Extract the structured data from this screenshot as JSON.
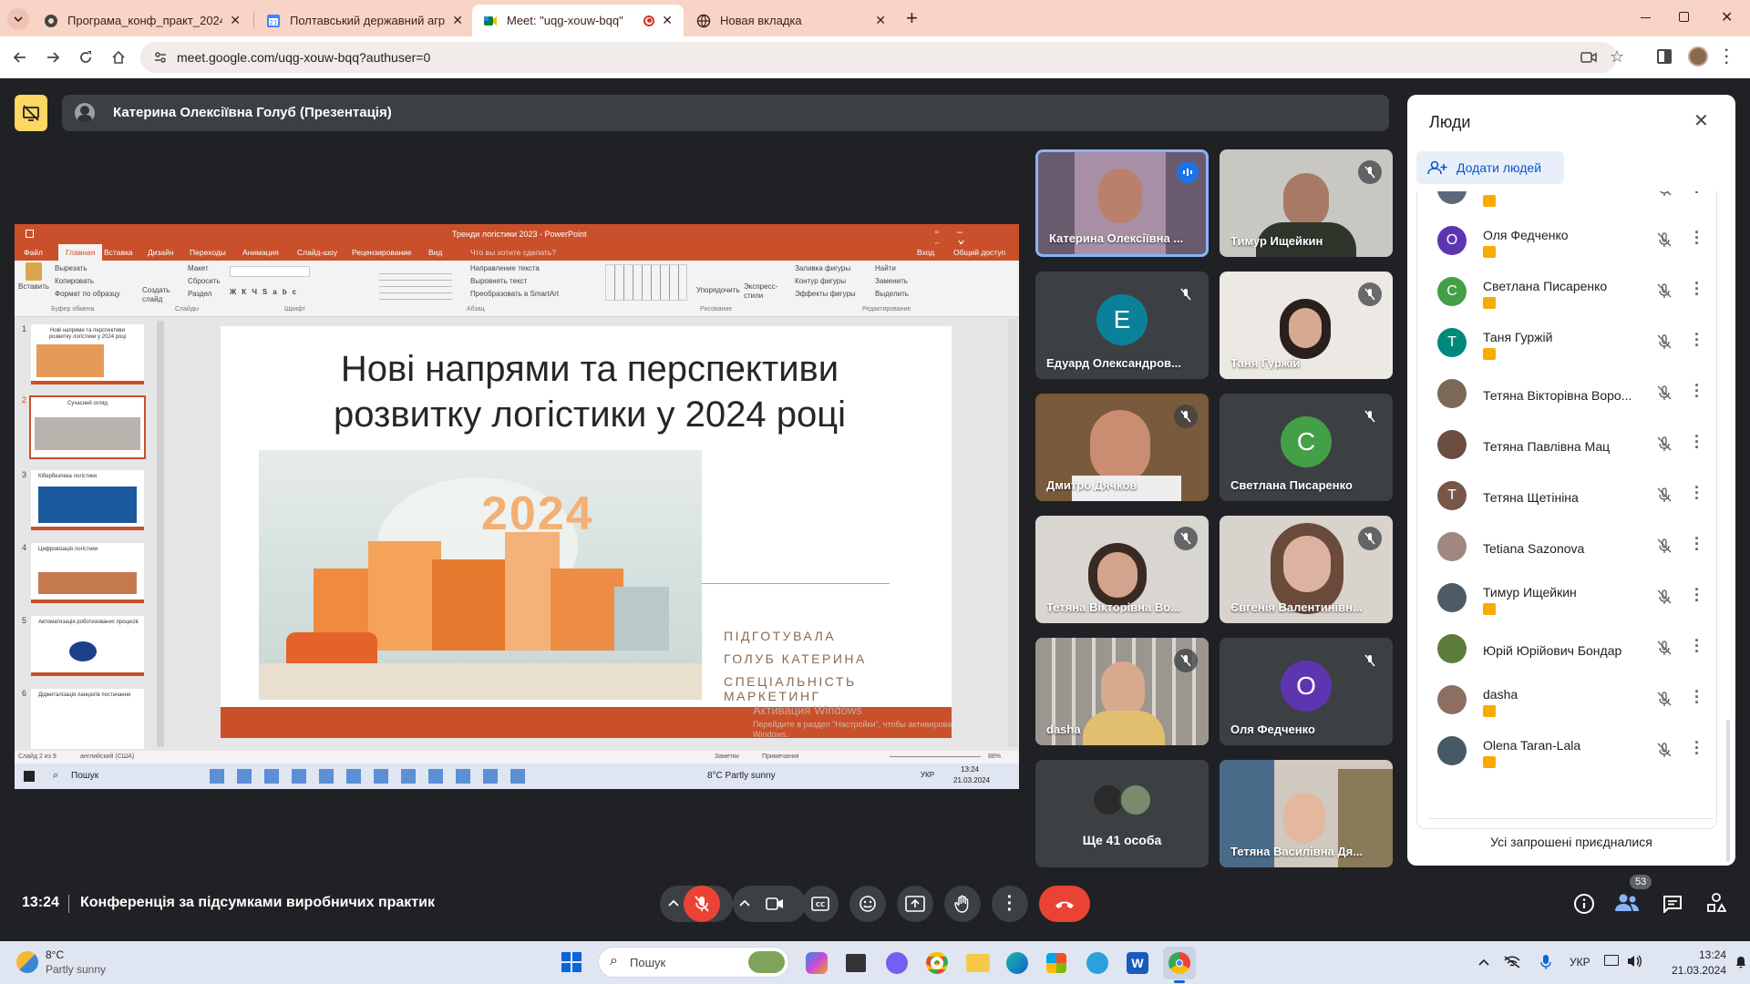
{
  "browser": {
    "tabs": [
      {
        "label": "Програма_конф_практ_2024.p",
        "icon": "doc-icon"
      },
      {
        "label": "Полтавський державний агра",
        "icon": "calendar-icon"
      },
      {
        "label": "Meet: \"uqg-xouw-bqq\"",
        "icon": "meet-icon"
      },
      {
        "label": "Новая вкладка",
        "icon": "new-tab-icon"
      }
    ],
    "url": "meet.google.com/uqg-xouw-bqq?authuser=0"
  },
  "presentation_bar": {
    "title": "Катерина Олексіївна Голуб (Презентація)"
  },
  "shared_screen": {
    "ppt_title": "Тренди логістики 2023 - PowerPoint",
    "ribbon_tabs": [
      "Файл",
      "Главная",
      "Вставка",
      "Дизайн",
      "Переходы",
      "Анимация",
      "Слайд-шоу",
      "Рецензирование",
      "Вид"
    ],
    "tell_me": "Что вы хотите сделать?",
    "signin": "Вход",
    "share": "Общий доступ",
    "clipboard": [
      "Вырезать",
      "Копировать",
      "Формат по образцу"
    ],
    "paste": "Вставить",
    "group_labels": [
      "Буфер обмена",
      "Слайды",
      "Шрифт",
      "Абзац",
      "Рисование",
      "Редактирование"
    ],
    "slide_btns": [
      "Создать слайд",
      "Макет",
      "Сбросить",
      "Раздел"
    ],
    "para_btns": [
      "Направление текста",
      "Выровнять текст",
      "Преобразовать в SmartArt"
    ],
    "draw_btns": [
      "Упорядочить",
      "Экспресс-стили",
      "Заливка фигуры",
      "Контур фигуры",
      "Эффекты фигуры"
    ],
    "edit_btns": [
      "Найти",
      "Заменить",
      "Выделить"
    ],
    "slide_title": "Нові напрями та перспективи розвитку логістики у 2024 році",
    "slide_year": "2024",
    "slide_author": [
      "ПІДГОТУВАЛА",
      "ГОЛУБ КАТЕРИНА",
      "СПЕЦІАЛЬНІСТЬ МАРКЕТИНГ"
    ],
    "activation": [
      "Активация Windows",
      "Перейдите в раздел \"Настройки\", чтобы активировать Windows."
    ],
    "thumbs": [
      {
        "n": "1",
        "title": "Нові напрями та перспективи розвитку логістики у 2024 році"
      },
      {
        "n": "2",
        "title": "Сучасний огляд"
      },
      {
        "n": "3",
        "title": "Кібербезпека логістики"
      },
      {
        "n": "4",
        "title": "Цифровізація логістики"
      },
      {
        "n": "5",
        "title": "Автоматизація роботизованих процесів"
      },
      {
        "n": "6",
        "title": "Діджиталізація ланцюгів постачання"
      }
    ],
    "status_left": "Слайд 2 из 9",
    "status_lang": "английский (США)",
    "status_notes": "Заметки",
    "status_comments": "Примечания",
    "zoom": "88%",
    "inner_taskbar": {
      "search": "Пошук",
      "weather": "8°C  Partly sunny",
      "lang": "УКР",
      "time": "13:24",
      "date": "21.03.2024"
    }
  },
  "tiles": [
    {
      "name": "Катерина Олексіївна ...",
      "kind": "video",
      "speaking": true
    },
    {
      "name": "Тимур Ищейкин",
      "kind": "video",
      "muted": true
    },
    {
      "name": "Едуард Олександров...",
      "kind": "avatar",
      "letter": "Е",
      "color": "#0b8199",
      "muted": true
    },
    {
      "name": "Таня Гуржій",
      "kind": "video",
      "muted": true
    },
    {
      "name": "Дмитро Дячков",
      "kind": "video",
      "muted": true
    },
    {
      "name": "Светлана Писаренко",
      "kind": "avatar",
      "letter": "С",
      "color": "#43a047",
      "muted": true
    },
    {
      "name": "Тетяна Вікторівна Во...",
      "kind": "video",
      "muted": true
    },
    {
      "name": "Євгенія Валентинівн...",
      "kind": "video",
      "muted": true
    },
    {
      "name": "dasha",
      "kind": "video",
      "muted": true
    },
    {
      "name": "Оля Федченко",
      "kind": "avatar",
      "letter": "О",
      "color": "#5e35b1",
      "muted": true
    },
    {
      "name": "Ще 41 особа",
      "kind": "more"
    },
    {
      "name": "Тетяна Василівна Дя...",
      "kind": "video"
    }
  ],
  "people_panel": {
    "title": "Люди",
    "add_people": "Додати людей",
    "people": [
      {
        "name": "Оля Федченко",
        "letter": "О",
        "color": "#5e35b1",
        "badge": true
      },
      {
        "name": "Светлана Писаренко",
        "letter": "С",
        "color": "#43a047",
        "badge": true
      },
      {
        "name": "Таня Гуржій",
        "letter": "Т",
        "color": "#00897b",
        "badge": true
      },
      {
        "name": "Тетяна Вікторівна Воро...",
        "letter": "",
        "color": "#7a6a55",
        "badge": false
      },
      {
        "name": "Тетяна Павлівна Мац",
        "letter": "",
        "color": "#6d4c41",
        "badge": false
      },
      {
        "name": "Тетяна Щетініна",
        "letter": "Т",
        "color": "#795548",
        "badge": false
      },
      {
        "name": "Tetiana Sazonova",
        "letter": "",
        "color": "#a1887f",
        "badge": false
      },
      {
        "name": "Тимур Ищейкин",
        "letter": "",
        "color": "#4e5b66",
        "badge": true
      },
      {
        "name": "Юрій Юрійович Бондар",
        "letter": "",
        "color": "#5d7b3a",
        "badge": false
      },
      {
        "name": "dasha",
        "letter": "",
        "color": "#8d6e63",
        "badge": true
      },
      {
        "name": "Olena Taran-Lala",
        "letter": "",
        "color": "#455a64",
        "badge": true
      }
    ],
    "footer": "Усі запрошені приєдналися"
  },
  "bottom_bar": {
    "time": "13:24",
    "meeting_name": "Конференція за підсумками виробничих практик",
    "participants_count": "53"
  },
  "windows_taskbar": {
    "temp": "8°C",
    "weather": "Partly sunny",
    "search": "Пошук",
    "lang": "УКР",
    "time": "13:24",
    "date": "21.03.2024"
  }
}
